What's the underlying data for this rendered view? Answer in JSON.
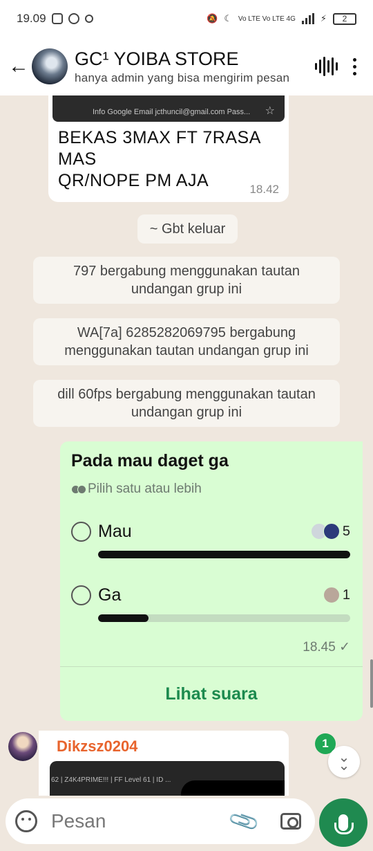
{
  "status_bar": {
    "time": "19.09",
    "network": "Vo LTE  Vo LTE 4G",
    "battery": "2"
  },
  "header": {
    "title": "GC¹ YOIBA STORE",
    "subtitle": "hanya admin yang bisa mengirim pesan"
  },
  "messages": {
    "prev_preview_text": "Info Google Email jcthuncil@gmail.com Pass...",
    "prev_text": "BEKAS 3MAX FT 7RASA MAS\nQR/NOPE PM AJA",
    "prev_time": "18.42",
    "system": [
      "~ Gbt keluar",
      "797 bergabung menggunakan tautan undangan grup ini",
      "WA[7a] 6285282069795 bergabung menggunakan tautan undangan grup ini",
      "dill 60fps bergabung menggunakan tautan undangan grup ini"
    ]
  },
  "poll": {
    "question": "Pada mau daget ga",
    "hint": "Pilih satu atau lebih",
    "options": [
      {
        "label": "Mau",
        "votes": "5",
        "fraction": 1.0
      },
      {
        "label": "Ga",
        "votes": "1",
        "fraction": 0.2
      }
    ],
    "time": "18.45",
    "view_votes": "Lihat suara"
  },
  "next_message": {
    "sender": "Dikzsz0204",
    "preview_text": "62 | Z4K4PRIME!!! | FF Level 61 | ID ..."
  },
  "unread_badge": "1",
  "input": {
    "placeholder": "Pesan"
  },
  "colors": {
    "poll_bg": "#d9fdd3",
    "accent_green": "#1c8a4e",
    "sender_name": "#e8642d",
    "chat_bg": "#efe7de"
  }
}
